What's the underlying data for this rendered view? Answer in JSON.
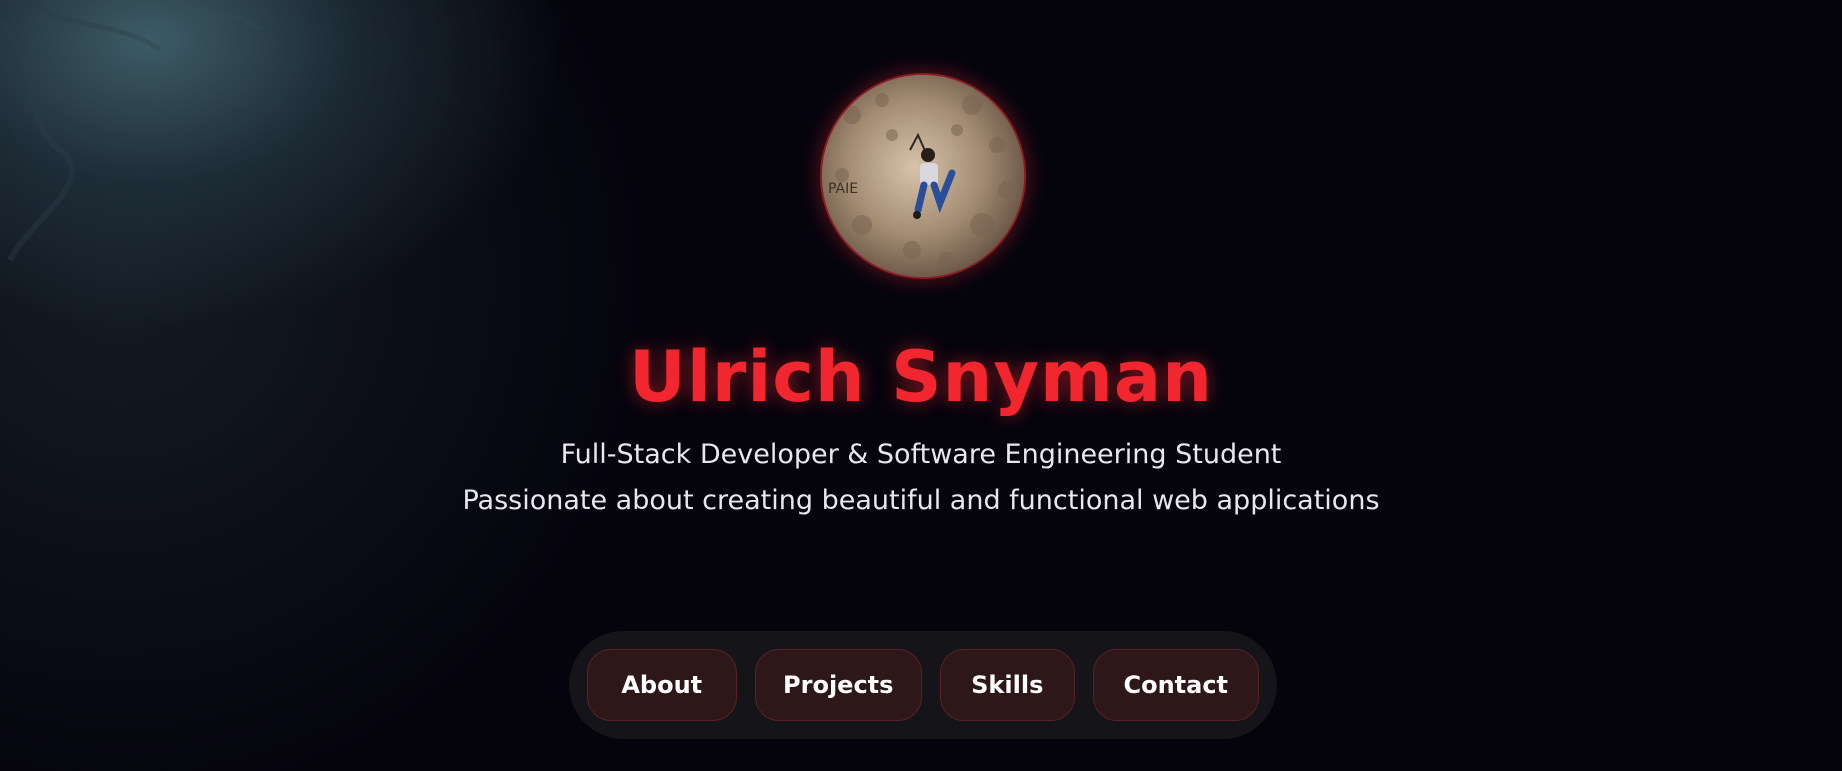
{
  "hero": {
    "name": "Ulrich Snyman",
    "tagline_line1": "Full-Stack Developer & Software Engineering Student",
    "tagline_line2": "Passionate about creating beautiful and functional web applications"
  },
  "nav": {
    "items": [
      {
        "label": "About"
      },
      {
        "label": "Projects"
      },
      {
        "label": "Skills"
      },
      {
        "label": "Contact"
      }
    ]
  },
  "colors": {
    "accent": "#f1262e",
    "background": "#05040d",
    "button_bg": "#2d1719",
    "nav_bg": "#151419"
  },
  "avatar": {
    "icon": "profile-photo"
  }
}
